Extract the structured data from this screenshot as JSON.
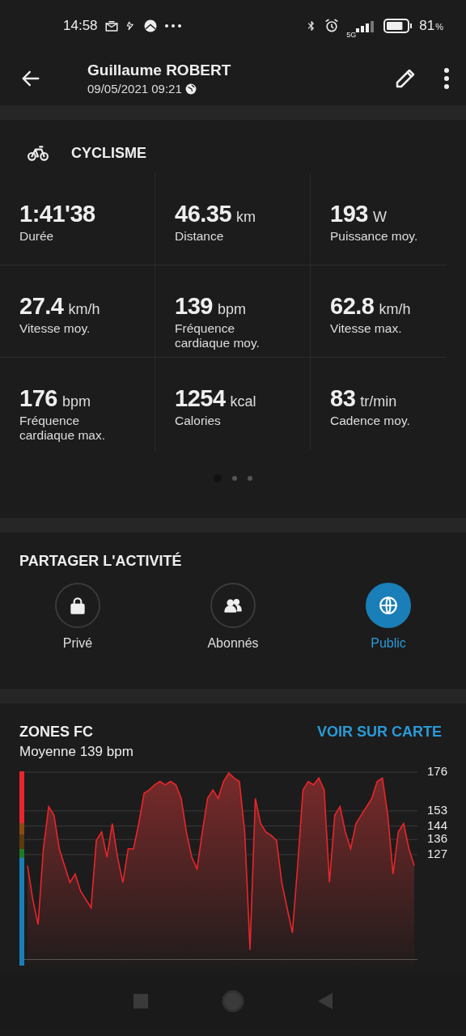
{
  "status_bar": {
    "time": "14:58",
    "battery": "81",
    "battery_unit": "%",
    "network": "5G"
  },
  "header": {
    "title": "Guillaume ROBERT",
    "subtitle": "09/05/2021 09:21"
  },
  "activity": {
    "sport": "CYCLISME",
    "stats": [
      {
        "value": "1:41'38",
        "label": "Durée"
      },
      {
        "value": "46.35",
        "unit": "km",
        "label": "Distance"
      },
      {
        "value": "193",
        "unit": "W",
        "label": "Puissance moy."
      },
      {
        "value": "27.4",
        "unit": "km/h",
        "label": "Vitesse moy."
      },
      {
        "value": "139",
        "unit": "bpm",
        "label": "Fréquence cardiaque moy."
      },
      {
        "value": "62.8",
        "unit": "km/h",
        "label": "Vitesse max."
      },
      {
        "value": "176",
        "unit": "bpm",
        "label": "Fréquence cardiaque max."
      },
      {
        "value": "1254",
        "unit": "kcal",
        "label": "Calories"
      },
      {
        "value": "83",
        "unit": "tr/min",
        "label": "Cadence moy."
      }
    ],
    "pages": [
      {
        "selected": true
      },
      {
        "selected": false
      },
      {
        "selected": false
      }
    ]
  },
  "share": {
    "title": "PARTAGER L'ACTIVITÉ",
    "options": [
      {
        "kind": "lock",
        "label": "Privé",
        "selected": false
      },
      {
        "kind": "people",
        "label": "Abonnés",
        "selected": false
      },
      {
        "kind": "globe",
        "label": "Public",
        "selected": true
      }
    ]
  },
  "hr_zones": {
    "title": "ZONES FC",
    "link": "VOIR SUR CARTE",
    "subtitle": "Moyenne 139 bpm",
    "chart_data": {
      "type": "area",
      "grid": true,
      "ylim": [
        64,
        176
      ],
      "yticks": [
        176,
        153,
        144,
        136,
        127
      ],
      "series": [
        {
          "color": "#e8262b",
          "values": [
            120,
            100,
            85,
            130,
            155,
            150,
            130,
            120,
            110,
            115,
            105,
            100,
            95,
            135,
            140,
            125,
            145,
            125,
            110,
            130,
            130,
            145,
            163,
            165,
            168,
            170,
            168,
            170,
            168,
            160,
            140,
            125,
            118,
            140,
            160,
            165,
            160,
            170,
            175,
            172,
            170,
            140,
            70,
            160,
            145,
            140,
            138,
            135,
            110,
            95,
            80,
            120,
            165,
            170,
            168,
            172,
            165,
            110,
            150,
            155,
            140,
            130,
            145,
            150,
            155,
            160,
            170,
            172,
            150,
            115,
            140,
            145,
            130,
            120
          ]
        }
      ]
    },
    "zones": [
      {
        "color": "#e8262b"
      },
      {
        "color": "#8a4a12"
      },
      {
        "color": "#5a3a10"
      },
      {
        "color": "#1f7a2a"
      },
      {
        "color": "#1a7fb8"
      }
    ]
  }
}
